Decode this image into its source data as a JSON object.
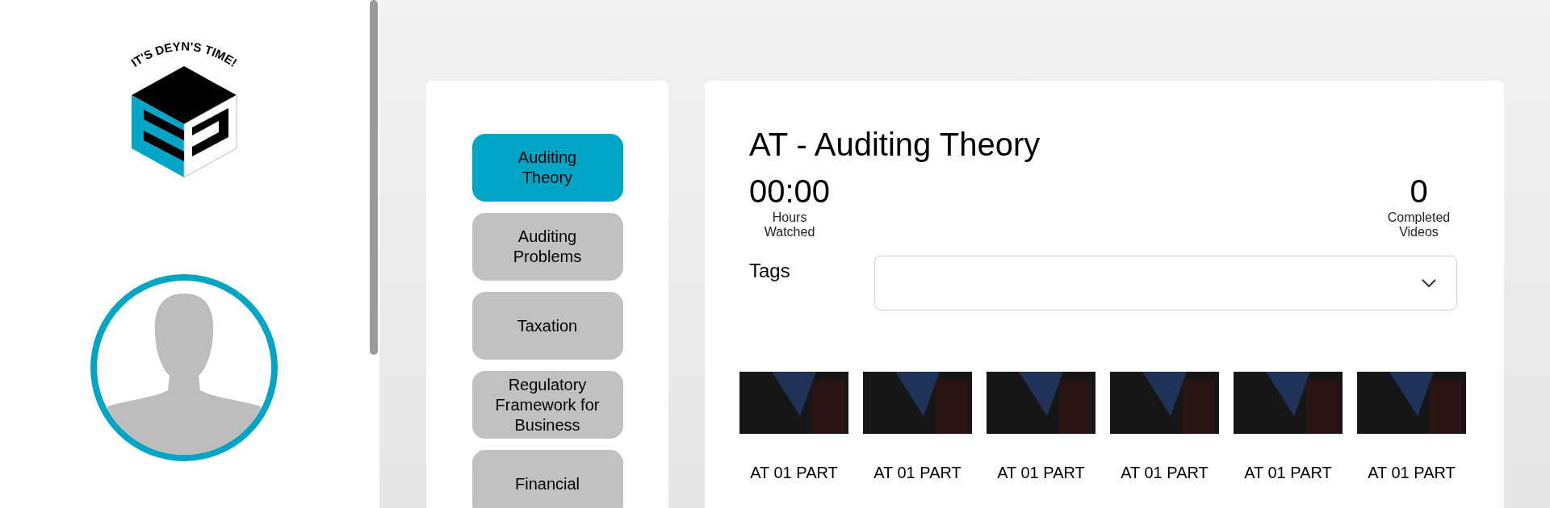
{
  "logo": {
    "tagline": "IT'S DEYN'S TIME!"
  },
  "categories": [
    {
      "label": "Auditing Theory",
      "selected": true
    },
    {
      "label": "Auditing Problems",
      "selected": false
    },
    {
      "label": "Taxation",
      "selected": false
    },
    {
      "label": "Regulatory Framework for Business",
      "selected": false
    },
    {
      "label": "Financial",
      "selected": false
    }
  ],
  "course": {
    "title": "AT - Auditing Theory",
    "hours_watched": {
      "value": "00:00",
      "label": "Hours Watched"
    },
    "completed_videos": {
      "value": "0",
      "label": "Completed Videos"
    },
    "tags": {
      "label": "Tags"
    }
  },
  "videos": [
    {
      "title": "AT 01 PART"
    },
    {
      "title": "AT 01 PART"
    },
    {
      "title": "AT 01 PART"
    },
    {
      "title": "AT 01 PART"
    },
    {
      "title": "AT 01 PART"
    },
    {
      "title": "AT 01 PART"
    }
  ]
}
